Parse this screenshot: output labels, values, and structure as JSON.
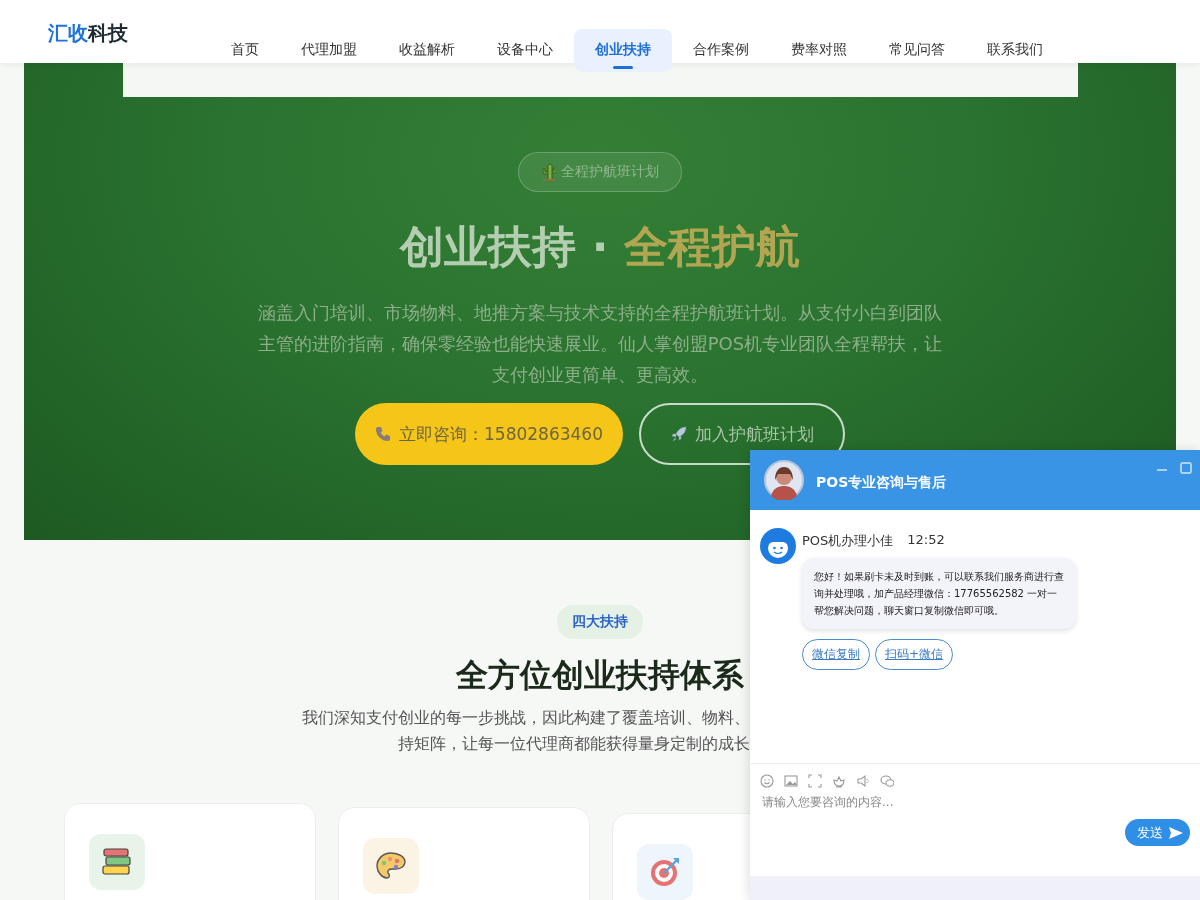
{
  "header": {
    "logo": [
      {
        "text": "汇收",
        "kind": "accent"
      },
      {
        "text": "科技",
        "kind": "plain"
      }
    ],
    "nav": [
      {
        "label": "首页",
        "selected": false
      },
      {
        "label": "代理加盟",
        "selected": false
      },
      {
        "label": "收益解析",
        "selected": false
      },
      {
        "label": "设备中心",
        "selected": false
      },
      {
        "label": "创业扶持",
        "selected": true
      },
      {
        "label": "合作案例",
        "selected": false
      },
      {
        "label": "费率对照",
        "selected": false
      },
      {
        "label": "常见问答",
        "selected": false
      },
      {
        "label": "联系我们",
        "selected": false
      }
    ]
  },
  "hero": {
    "badge": "全程护航班计划",
    "title": [
      {
        "text": "创业扶持",
        "kind": "plain"
      },
      {
        "text": " · ",
        "kind": "plain"
      },
      {
        "text": "全程护航",
        "kind": "accent"
      }
    ],
    "description": "涵盖入门培训、市场物料、地推方案与技术支持的全程护航班计划。从支付小白到团队主管的进阶指南，确保零经验也能快速展业。仙人掌创盟POS机专业团队全程帮扶，让支付创业更简单、更高效。",
    "buttons": [
      {
        "label": "立即咨询：15802863460",
        "kind": "primary"
      },
      {
        "label": "加入护航班计划",
        "kind": "outline"
      }
    ]
  },
  "support": {
    "tag": "四大扶持",
    "heading": "全方位创业扶持体系",
    "description_lines": [
      "我们深知支付创业的每一步挑战，因此构建了覆盖培训、物料、",
      "持矩阵，让每一位代理商都能获得量身定制的成长"
    ],
    "cards": [
      {
        "kind": "books"
      },
      {
        "kind": "palette"
      },
      {
        "kind": "target"
      }
    ]
  },
  "chat": {
    "title": "POS专业咨询与售后",
    "agent_name": "POS机办理小佳",
    "time": "12:52",
    "message": "您好！如果刷卡未及时到账，可以联系我们服务商进行查询并处理哦，加产品经理微信：17765562582 一对一帮您解决问题，聊天窗口复制微信即可哦。",
    "quick_replies": [
      "微信复制",
      "扫码+微信"
    ],
    "input": {
      "placeholder": "请输入您要咨询的内容..."
    },
    "send": "发送"
  }
}
